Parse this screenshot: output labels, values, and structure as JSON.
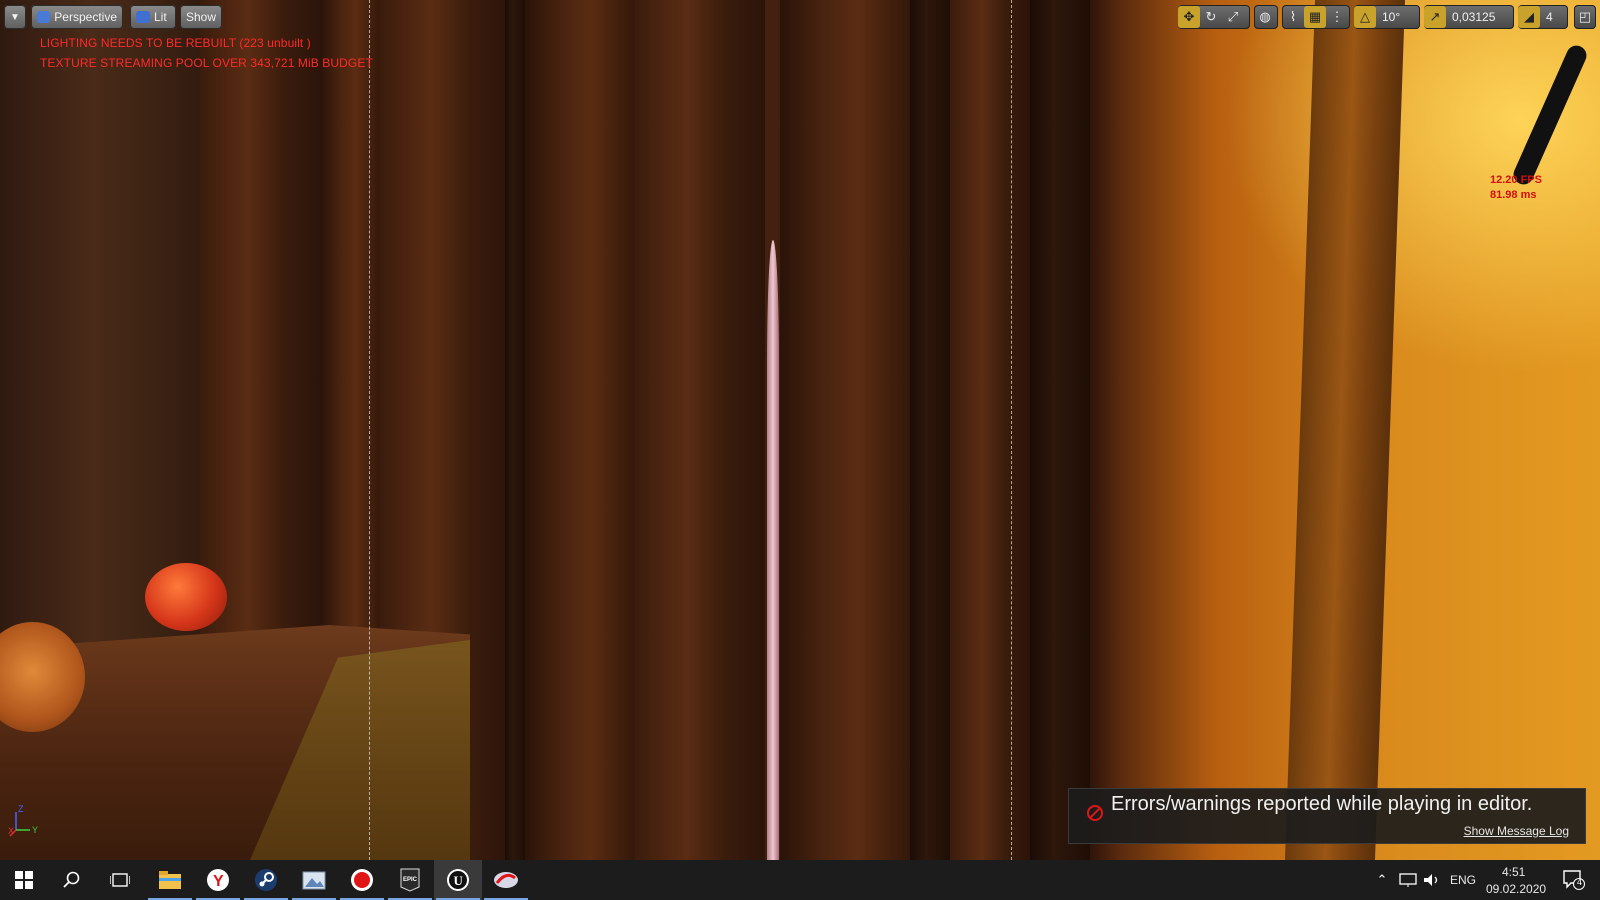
{
  "viewport_toolbar": {
    "menu_icon": "chevron-down-icon",
    "perspective_label": "Perspective",
    "lit_label": "Lit",
    "show_label": "Show"
  },
  "right_toolbar": {
    "icons": [
      "move-icon",
      "rotate-icon",
      "scale-icon",
      "world-icon",
      "surface-snap-icon",
      "grid-icon",
      "grid-snap-icon",
      "rotation-snap-icon",
      "scale-snap-icon",
      "camera-speed-icon",
      "maximize-icon"
    ],
    "rotation_snap": "10°",
    "scale_snap": "0,03125",
    "camera_speed": "4",
    "accent_color": "#c9a22b"
  },
  "warnings": {
    "line1": "LIGHTING NEEDS TO BE REBUILT (223 unbuilt )",
    "line2": "TEXTURE STREAMING POOL OVER 343,721 MiB BUDGET",
    "color": "#ff2a2a"
  },
  "stats": {
    "fps": "12.20 FPS",
    "ms": "81.98 ms"
  },
  "axis": {
    "x_label": "X",
    "y_label": "Y",
    "z_label": "Z"
  },
  "notification": {
    "message": "Errors/warnings reported while playing in editor.",
    "link": "Show Message Log",
    "icon": "error-icon"
  },
  "taskbar": {
    "apps": [
      "windows-start-icon",
      "search-icon",
      "task-view-icon",
      "file-explorer-icon",
      "yandex-browser-icon",
      "steam-icon",
      "image-viewer-icon",
      "recorder-icon",
      "epic-games-icon",
      "unreal-engine-icon",
      "fleet-icon"
    ],
    "language": "ENG",
    "time": "4:51",
    "date": "09.02.2020",
    "notification_count": "4"
  }
}
